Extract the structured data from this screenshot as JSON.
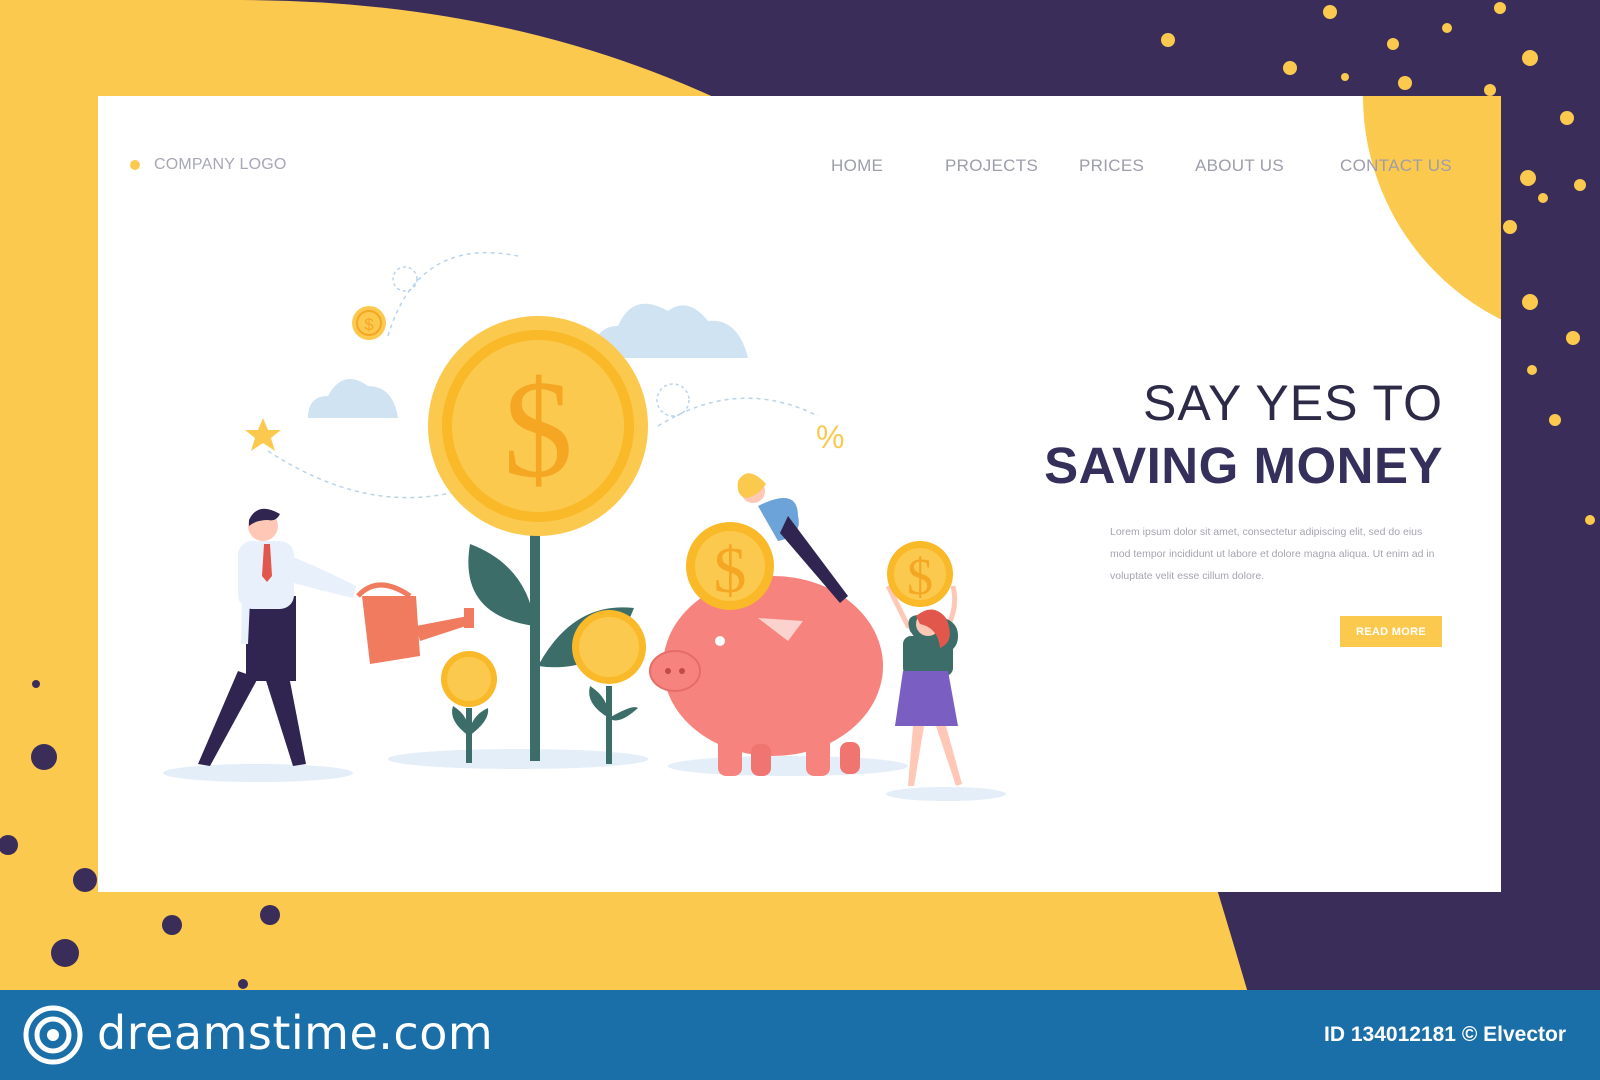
{
  "colors": {
    "accent": "#fcc94f",
    "dark": "#3b2d59",
    "text_dark": "#352f5b",
    "footer": "#1b6fa8"
  },
  "header": {
    "logo_label": "COMPANY LOGO",
    "nav": [
      "HOME",
      "PROJECTS",
      "PRICES",
      "ABOUT US",
      "CONTACT US"
    ]
  },
  "hero": {
    "line1": "SAY YES TO",
    "line2": "SAVING MONEY",
    "description": "Lorem ipsum dolor sit amet, consectetur adipiscing elit, sed do eius mod tempor incididunt ut labore et dolore magna aliqua. Ut enim ad in voluptate velit esse cillum dolore.",
    "cta": "READ MORE"
  },
  "illustration": {
    "coin_symbol": "$",
    "percent_symbol": "%"
  },
  "footer": {
    "brand": "dreamstime.com",
    "image_id": "ID 134012181 © Elvector"
  }
}
